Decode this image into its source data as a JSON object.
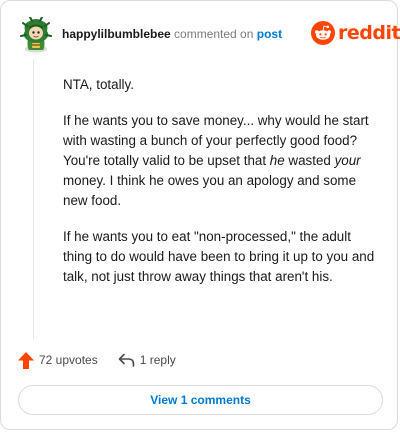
{
  "header": {
    "username": "happylilbumblebee",
    "commented_text": "commented on",
    "post_link": "post",
    "brand": "reddit"
  },
  "comment": {
    "paragraphs": [
      {
        "parts": [
          {
            "text": "NTA, totally.",
            "italic": false
          }
        ]
      },
      {
        "parts": [
          {
            "text": "If he wants you to save money... why would he start with wasting a bunch of your perfectly good food? You're totally valid to be upset that ",
            "italic": false
          },
          {
            "text": "he",
            "italic": true
          },
          {
            "text": " wasted ",
            "italic": false
          },
          {
            "text": "your",
            "italic": true
          },
          {
            "text": " money. I think he owes you an apology and some new food.",
            "italic": false
          }
        ]
      },
      {
        "parts": [
          {
            "text": "If he wants you to eat \"non-processed,\" the adult thing to do would have been to bring it up to you and talk, not just throw away things that aren't his.",
            "italic": false
          }
        ]
      }
    ]
  },
  "actions": {
    "upvotes": "72 upvotes",
    "replies": "1 reply"
  },
  "footer": {
    "view_comments": "View 1 comments"
  },
  "colors": {
    "brand": "#ff4500",
    "link": "#0079d3",
    "upvote": "#ff4500"
  }
}
